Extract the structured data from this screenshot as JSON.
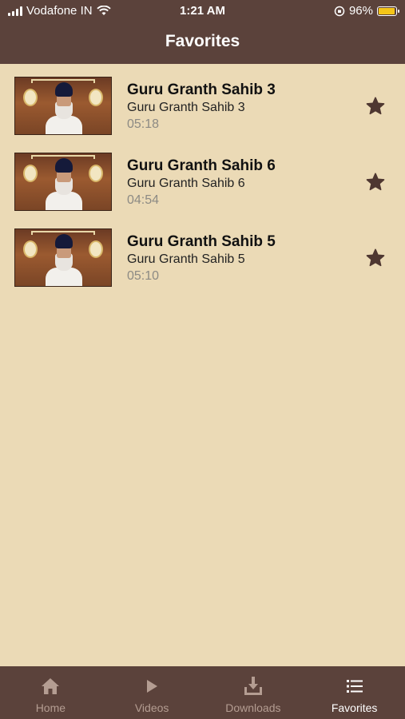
{
  "status_bar": {
    "carrier": "Vodafone IN",
    "time": "1:21 AM",
    "battery_percent": "96%",
    "battery_level": 0.96,
    "battery_color": "#F5C518"
  },
  "header": {
    "title": "Favorites"
  },
  "favorites": [
    {
      "title": "Guru Granth Sahib 3",
      "subtitle": "Guru Granth Sahib 3",
      "duration": "05:18",
      "icon": "star-icon"
    },
    {
      "title": "Guru Granth Sahib 6",
      "subtitle": "Guru Granth Sahib 6",
      "duration": "04:54",
      "icon": "star-icon"
    },
    {
      "title": "Guru Granth Sahib 5",
      "subtitle": "Guru Granth Sahib 5",
      "duration": "05:10",
      "icon": "star-icon"
    }
  ],
  "tabs": [
    {
      "label": "Home",
      "icon": "home-icon",
      "active": false
    },
    {
      "label": "Videos",
      "icon": "play-icon",
      "active": false
    },
    {
      "label": "Downloads",
      "icon": "download-icon",
      "active": false
    },
    {
      "label": "Favorites",
      "icon": "list-icon",
      "active": true
    }
  ],
  "colors": {
    "bar_background": "#5B423B",
    "page_background": "#EBDAB6",
    "tab_inactive": "#B49D92",
    "tab_active": "#FFFFFF"
  }
}
